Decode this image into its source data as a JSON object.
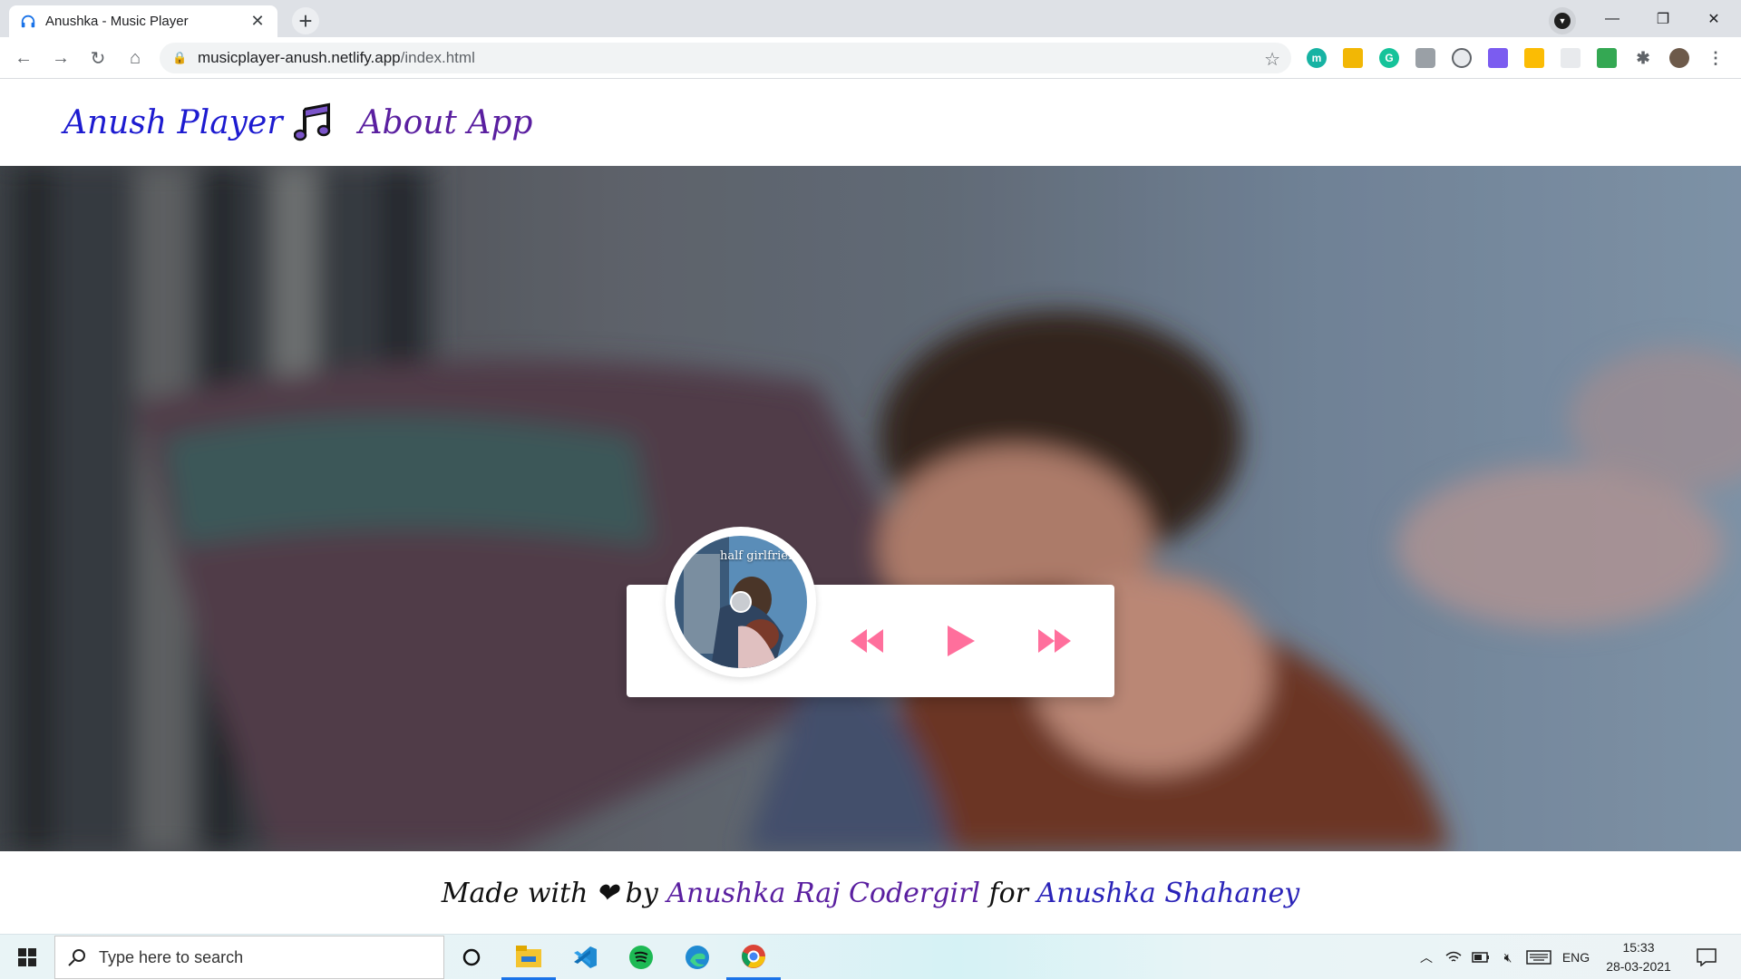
{
  "browser": {
    "tab_title": "Anushka - Music Player",
    "url_host": "musicplayer-anush.netlify.app",
    "url_path": "/index.html"
  },
  "site": {
    "brand": "Anush Player",
    "nav_about": "About App",
    "album_art_text": "half girlfriend",
    "footer": {
      "made_with": "Made with",
      "heart": "❤",
      "by": "by",
      "author": "Anushka Raj Codergirl",
      "for": "for",
      "recipient": "Anushka Shahaney"
    }
  },
  "player": {
    "accent": "#ff6f9c",
    "controls": [
      "previous",
      "play",
      "next"
    ]
  },
  "taskbar": {
    "search_placeholder": "Type here to search",
    "language": "ENG",
    "time": "15:33",
    "date": "28-03-2021"
  }
}
